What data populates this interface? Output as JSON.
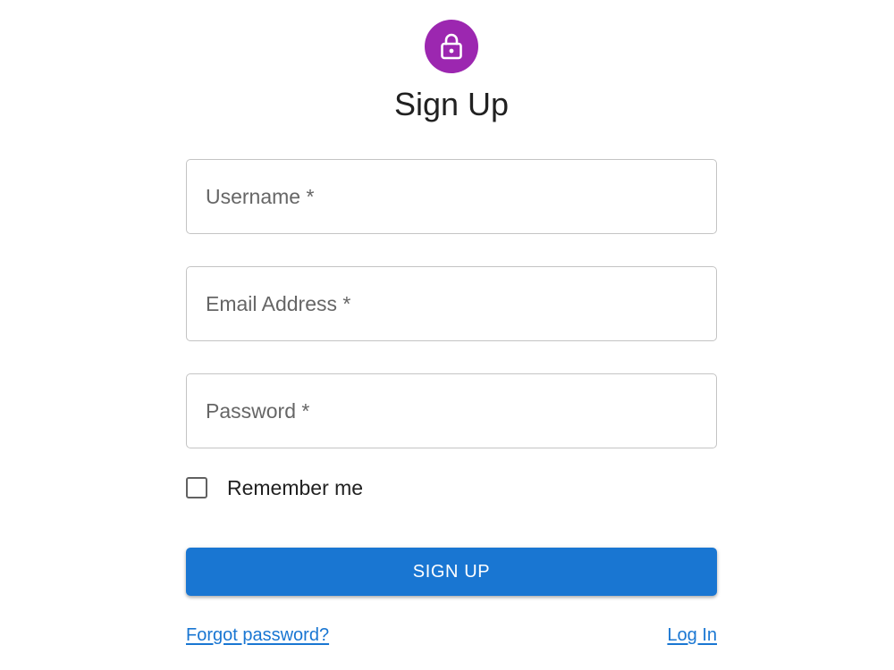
{
  "header": {
    "icon": "lock-icon",
    "title": "Sign Up"
  },
  "form": {
    "username": {
      "placeholder": "Username *",
      "value": ""
    },
    "email": {
      "placeholder": "Email Address *",
      "value": ""
    },
    "password": {
      "placeholder": "Password *",
      "value": ""
    },
    "remember": {
      "label": "Remember me",
      "checked": false
    },
    "submit_label": "SIGN UP"
  },
  "links": {
    "forgot_password": "Forgot password?",
    "log_in": "Log In"
  },
  "colors": {
    "accent": "#9c27b0",
    "primary": "#1976d2"
  }
}
